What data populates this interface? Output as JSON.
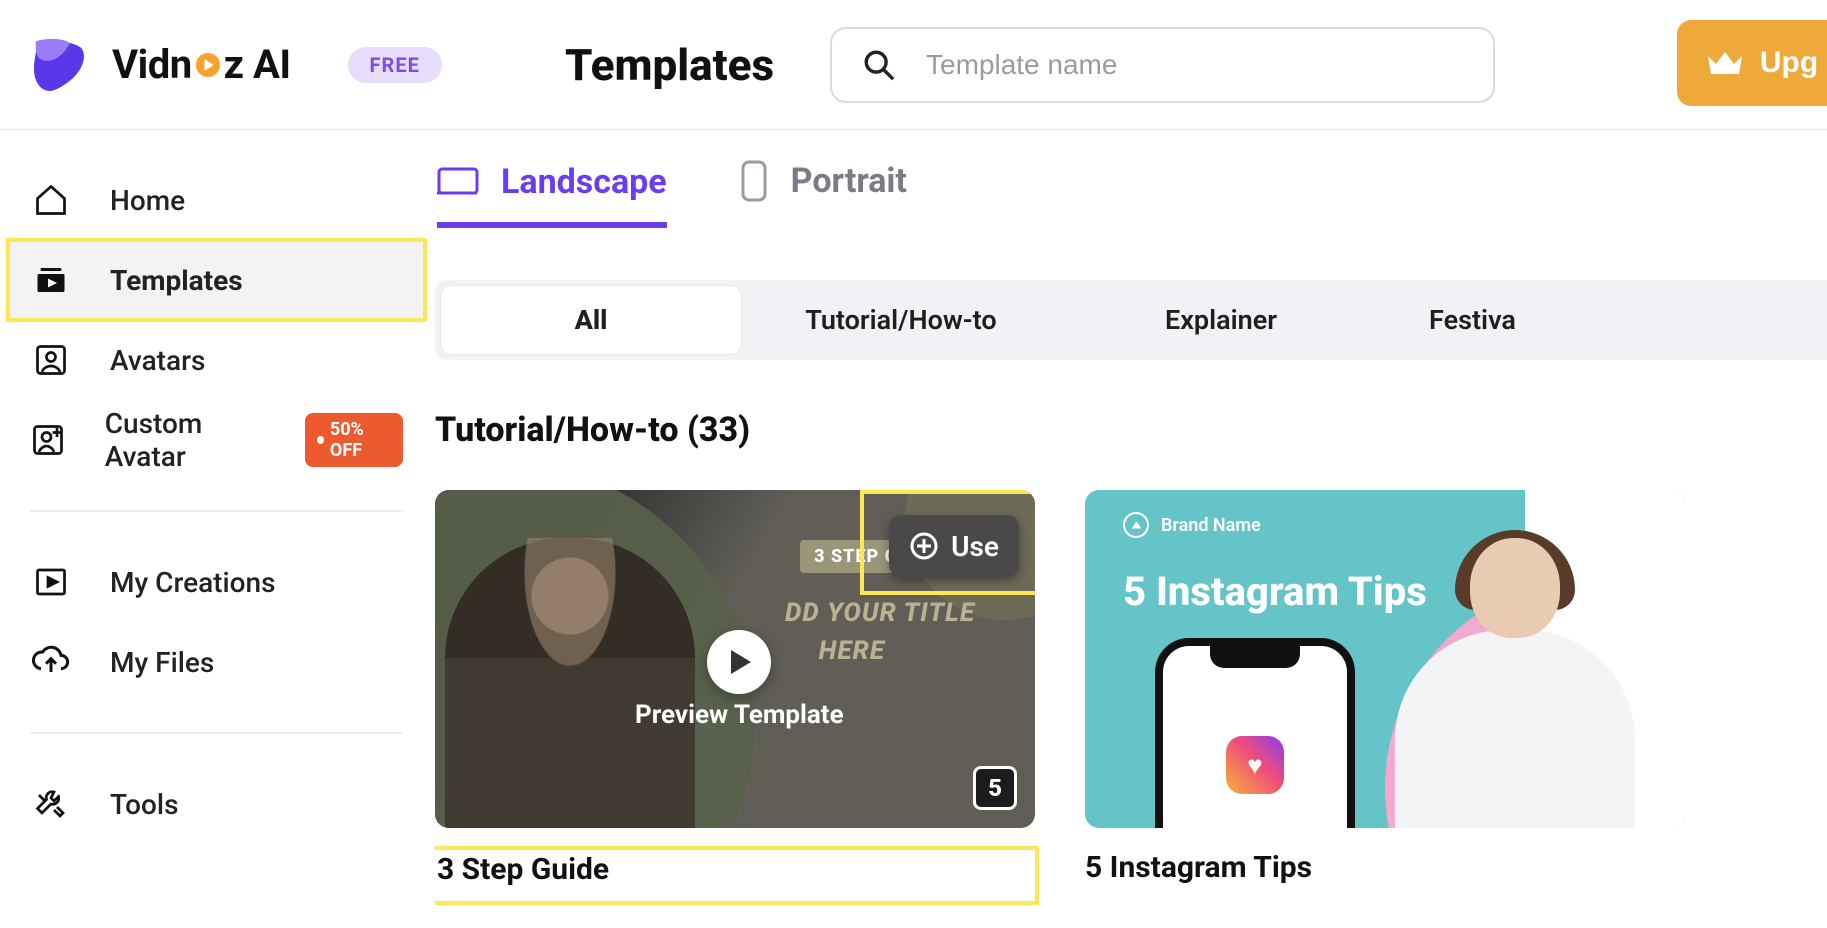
{
  "header": {
    "brand_left": "Vidn",
    "brand_right": "z AI",
    "free_badge": "FREE",
    "page_title": "Templates",
    "search_placeholder": "Template name",
    "upgrade_label": "Upg"
  },
  "sidebar": {
    "items": [
      {
        "label": "Home"
      },
      {
        "label": "Templates"
      },
      {
        "label": "Avatars"
      },
      {
        "label": "Custom Avatar",
        "badge": "50% OFF"
      },
      {
        "label": "My Creations"
      },
      {
        "label": "My Files"
      },
      {
        "label": "Tools"
      }
    ]
  },
  "orientation_tabs": {
    "landscape": "Landscape",
    "portrait": "Portrait"
  },
  "category_tabs": [
    "All",
    "Tutorial/How-to",
    "Explainer",
    "Festiva"
  ],
  "section": {
    "title": "Tutorial/How-to (33)"
  },
  "cards": [
    {
      "title": "3 Step Guide",
      "use_label": "Use",
      "preview_label": "Preview Template",
      "page_count": "5",
      "thumb_badge": "3 STEP GUIDE",
      "thumb_line1": "DD YOUR TITLE",
      "thumb_line2": "HERE"
    },
    {
      "title": "5 Instagram Tips",
      "brand_label": "Brand Name",
      "thumb_title": "5 Instagram Tips"
    }
  ]
}
